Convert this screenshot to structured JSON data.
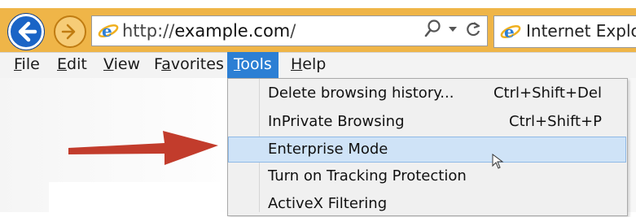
{
  "browser": {
    "address": {
      "prefix": "http://",
      "host": "example.com",
      "suffix": "/"
    },
    "tab_title": "Internet Explorer"
  },
  "menubar": {
    "items": [
      {
        "label": "File",
        "underline_letter": "F"
      },
      {
        "label": "Edit",
        "underline_letter": "E"
      },
      {
        "label": "View",
        "underline_letter": "V"
      },
      {
        "label": "Favorites",
        "underline_letter": "a"
      },
      {
        "label": "Tools",
        "underline_letter": "T",
        "active": true
      },
      {
        "label": "Help",
        "underline_letter": "H"
      }
    ]
  },
  "tools_menu": {
    "items": [
      {
        "label": "Delete browsing history...",
        "shortcut": "Ctrl+Shift+Del"
      },
      {
        "label": "InPrivate Browsing",
        "shortcut": "Ctrl+Shift+P"
      },
      {
        "label": "Enterprise Mode",
        "shortcut": "",
        "highlighted": true
      },
      {
        "label": "Turn on Tracking Protection",
        "shortcut": ""
      },
      {
        "label": "ActiveX Filtering",
        "shortcut": ""
      }
    ]
  },
  "colors": {
    "chrome": "#efb548",
    "menu_active": "#2c7fd4",
    "highlight": "#cfe3f7",
    "annotation_arrow": "#c0392b"
  },
  "icons": {
    "back": "back-arrow-icon",
    "forward": "forward-arrow-icon",
    "ie": "internet-explorer-logo-icon",
    "search": "search-icon",
    "refresh": "refresh-icon",
    "annotation": "red-arrow-icon",
    "cursor": "mouse-cursor-icon"
  }
}
